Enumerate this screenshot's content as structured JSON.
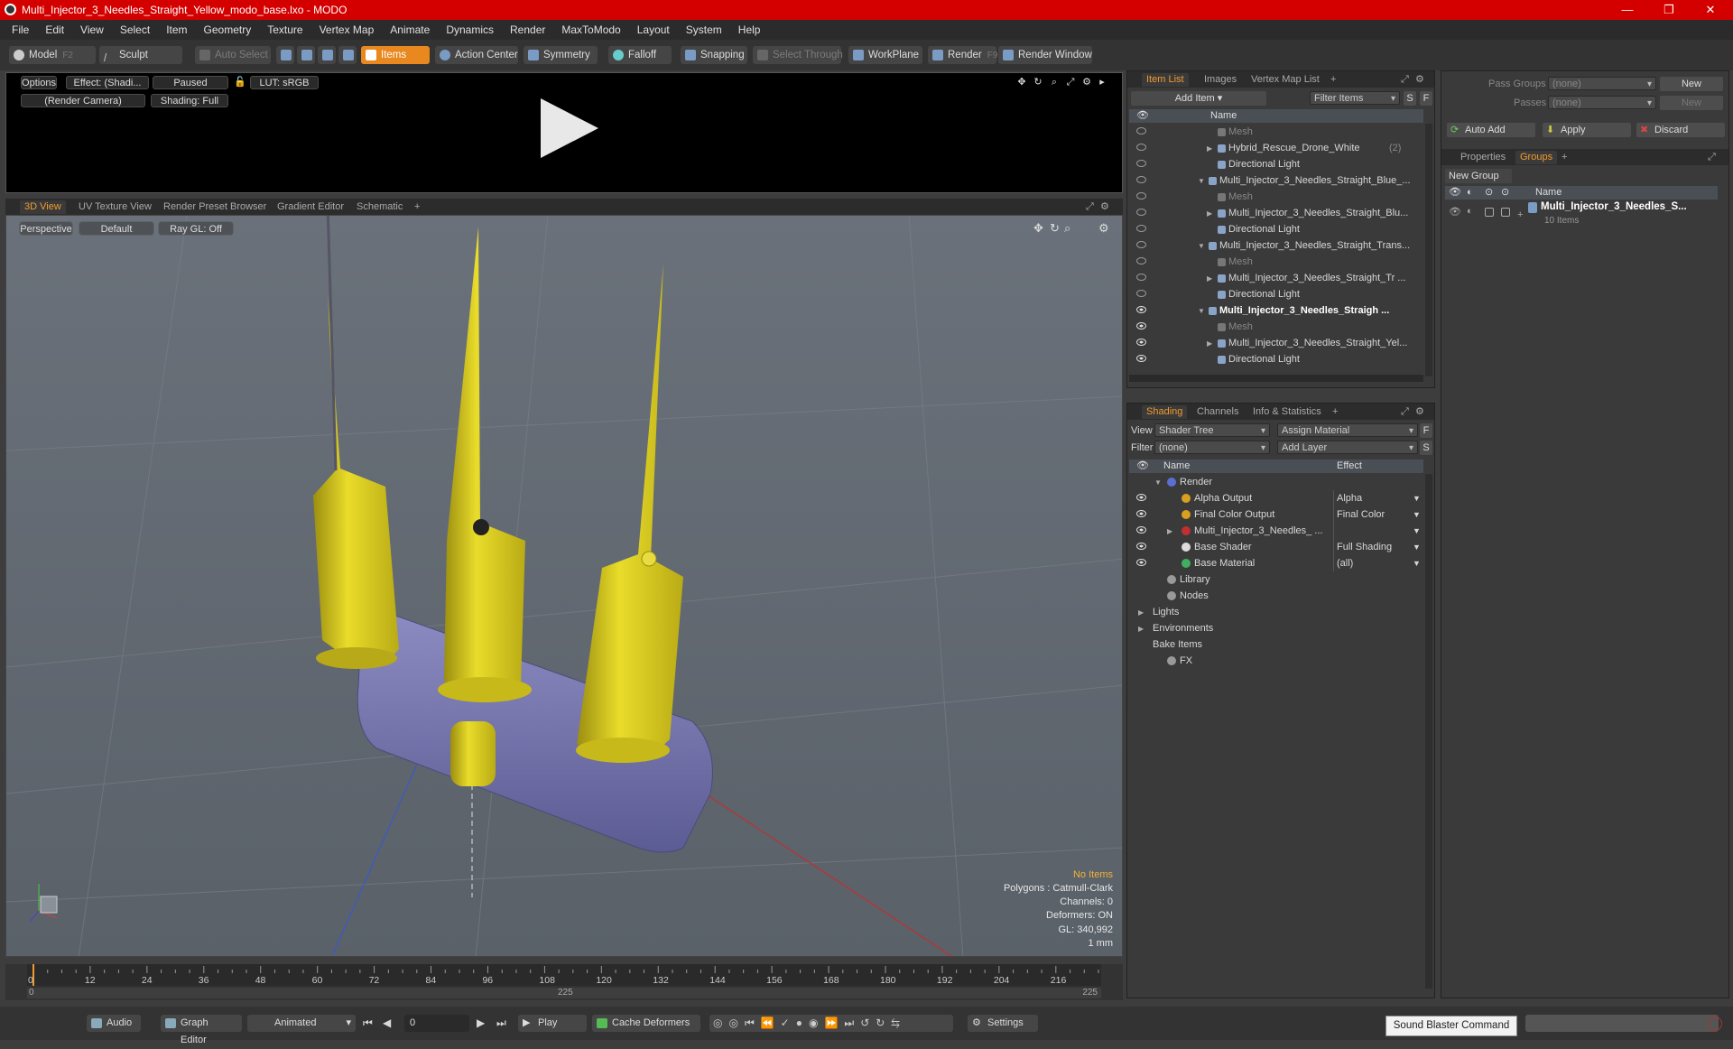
{
  "window": {
    "title": "Multi_Injector_3_Needles_Straight_Yellow_modo_base.lxo - MODO",
    "min": "—",
    "max": "❐",
    "close": "✕"
  },
  "menu": [
    "File",
    "Edit",
    "View",
    "Select",
    "Item",
    "Geometry",
    "Texture",
    "Vertex Map",
    "Animate",
    "Dynamics",
    "Render",
    "MaxToModo",
    "Layout",
    "System",
    "Help"
  ],
  "toolbar": {
    "model": "Model",
    "model_key": "F2",
    "sculpt": "Sculpt",
    "auto_select": "Auto Select",
    "items": "Items",
    "action_center": "Action Center",
    "symmetry": "Symmetry",
    "falloff": "Falloff",
    "snapping": "Snapping",
    "select_through": "Select Through",
    "workplane": "WorkPlane",
    "render": "Render",
    "render_key": "F9",
    "render_window": "Render Window"
  },
  "preview": {
    "options": "Options",
    "effect": "Effect: (Shadi...",
    "paused": "Paused",
    "lut": "LUT: sRGB",
    "camera": "(Render Camera)",
    "shading": "Shading: Full"
  },
  "view_tabs": [
    "3D View",
    "UV Texture View",
    "Render Preset Browser",
    "Gradient Editor",
    "Schematic",
    "+"
  ],
  "viewport": {
    "perspective": "Perspective",
    "default": "Default",
    "raygl": "Ray GL: Off",
    "stats": {
      "no_items": "No Items",
      "polygons": "Polygons : Catmull-Clark",
      "channels": "Channels: 0",
      "deformers": "Deformers: ON",
      "gl": "GL: 340,992",
      "unit": "1 mm"
    }
  },
  "timeline": {
    "ticks": [
      "0",
      "12",
      "24",
      "36",
      "48",
      "60",
      "72",
      "84",
      "96",
      "108",
      "120",
      "132",
      "144",
      "156",
      "168",
      "180",
      "192",
      "204",
      "216"
    ],
    "start": "0",
    "mid": "225",
    "end": "225"
  },
  "bottom": {
    "audio": "Audio",
    "graph_editor": "Graph Editor",
    "animated": "Animated",
    "frame": "0",
    "play": "Play",
    "cache": "Cache Deformers",
    "settings": "Settings"
  },
  "tooltip": "Sound Blaster Command",
  "item_list": {
    "tabs": [
      "Item List",
      "Images",
      "Vertex Map List",
      "+"
    ],
    "add_item": "Add Item",
    "filter": "Filter Items",
    "s": "S",
    "f": "F",
    "col_name": "Name",
    "rows": [
      {
        "label": "Mesh",
        "indent": 2,
        "grey": true,
        "eye": false,
        "arrow": ""
      },
      {
        "label": "Hybrid_Rescue_Drone_White",
        "suffix": "(2)",
        "indent": 2,
        "grey": false,
        "eye": false,
        "arrow": "▶"
      },
      {
        "label": "Directional Light",
        "indent": 2,
        "grey": false,
        "eye": false,
        "arrow": ""
      },
      {
        "label": "Multi_Injector_3_Needles_Straight_Blue_...",
        "indent": 1,
        "grey": false,
        "eye": false,
        "arrow": "▼"
      },
      {
        "label": "Mesh",
        "indent": 2,
        "grey": true,
        "eye": false,
        "arrow": ""
      },
      {
        "label": "Multi_Injector_3_Needles_Straight_Blu...",
        "indent": 2,
        "grey": false,
        "eye": false,
        "arrow": "▶"
      },
      {
        "label": "Directional Light",
        "indent": 2,
        "grey": false,
        "eye": false,
        "arrow": ""
      },
      {
        "label": "Multi_Injector_3_Needles_Straight_Trans...",
        "indent": 1,
        "grey": false,
        "eye": false,
        "arrow": "▼"
      },
      {
        "label": "Mesh",
        "indent": 2,
        "grey": true,
        "eye": false,
        "arrow": ""
      },
      {
        "label": "Multi_Injector_3_Needles_Straight_Tr ...",
        "indent": 2,
        "grey": false,
        "eye": false,
        "arrow": "▶"
      },
      {
        "label": "Directional Light",
        "indent": 2,
        "grey": false,
        "eye": false,
        "arrow": ""
      },
      {
        "label": "Multi_Injector_3_Needles_Straigh ...",
        "indent": 1,
        "grey": false,
        "eye": true,
        "arrow": "▼",
        "bold": true
      },
      {
        "label": "Mesh",
        "indent": 2,
        "grey": true,
        "eye": true,
        "arrow": ""
      },
      {
        "label": "Multi_Injector_3_Needles_Straight_Yel...",
        "indent": 2,
        "grey": false,
        "eye": true,
        "arrow": "▶"
      },
      {
        "label": "Directional Light",
        "indent": 2,
        "grey": false,
        "eye": true,
        "arrow": ""
      }
    ]
  },
  "shading": {
    "tabs": [
      "Shading",
      "Channels",
      "Info & Statistics",
      "+"
    ],
    "view_label": "View",
    "view_value": "Shader Tree",
    "assign": "Assign Material",
    "filter_label": "Filter",
    "filter_value": "(none)",
    "add_layer": "Add Layer",
    "f": "F",
    "s": "S",
    "col_name": "Name",
    "col_effect": "Effect",
    "rows": [
      {
        "label": "Render",
        "effect": "",
        "indent": 0,
        "eye": false,
        "arrow": "▼",
        "icon": "#5a6fd0"
      },
      {
        "label": "Alpha Output",
        "effect": "Alpha",
        "indent": 1,
        "eye": true,
        "arrow": "",
        "icon": "#d9a020"
      },
      {
        "label": "Final Color Output",
        "effect": "Final Color",
        "indent": 1,
        "eye": true,
        "arrow": "",
        "icon": "#d9a020"
      },
      {
        "label": "Multi_Injector_3_Needles_ ...",
        "effect": "",
        "indent": 1,
        "eye": true,
        "arrow": "▶",
        "icon": "#c03030"
      },
      {
        "label": "Base Shader",
        "effect": "Full Shading",
        "indent": 1,
        "eye": true,
        "arrow": "",
        "icon": "#dddddd"
      },
      {
        "label": "Base Material",
        "effect": "(all)",
        "indent": 1,
        "eye": true,
        "arrow": "",
        "icon": "#40b060"
      },
      {
        "label": "Library",
        "effect": "",
        "indent": 0,
        "eye": false,
        "arrow": "",
        "icon": "#999"
      },
      {
        "label": "Nodes",
        "effect": "",
        "indent": 0,
        "eye": false,
        "arrow": "",
        "icon": "#999"
      },
      {
        "label": "Lights",
        "effect": "",
        "indent": -1,
        "eye": false,
        "arrow": "▶",
        "icon": ""
      },
      {
        "label": "Environments",
        "effect": "",
        "indent": -1,
        "eye": false,
        "arrow": "▶",
        "icon": ""
      },
      {
        "label": "Bake Items",
        "effect": "",
        "indent": -1,
        "eye": false,
        "arrow": "",
        "icon": ""
      },
      {
        "label": "FX",
        "effect": "",
        "indent": 0,
        "eye": false,
        "arrow": "",
        "icon": "#999"
      }
    ]
  },
  "groups": {
    "pass_groups": "Pass Groups",
    "pass_value": "(none)",
    "new": "New",
    "passes": "Passes",
    "passes_value": "(none)",
    "new2": "New",
    "auto_add": "Auto Add",
    "apply": "Apply",
    "discard": "Discard",
    "tabs": [
      "Properties",
      "Groups",
      "+"
    ],
    "new_group": "New Group",
    "col_name": "Name",
    "item_name": "Multi_Injector_3_Needles_S...",
    "item_count": "10 Items"
  }
}
